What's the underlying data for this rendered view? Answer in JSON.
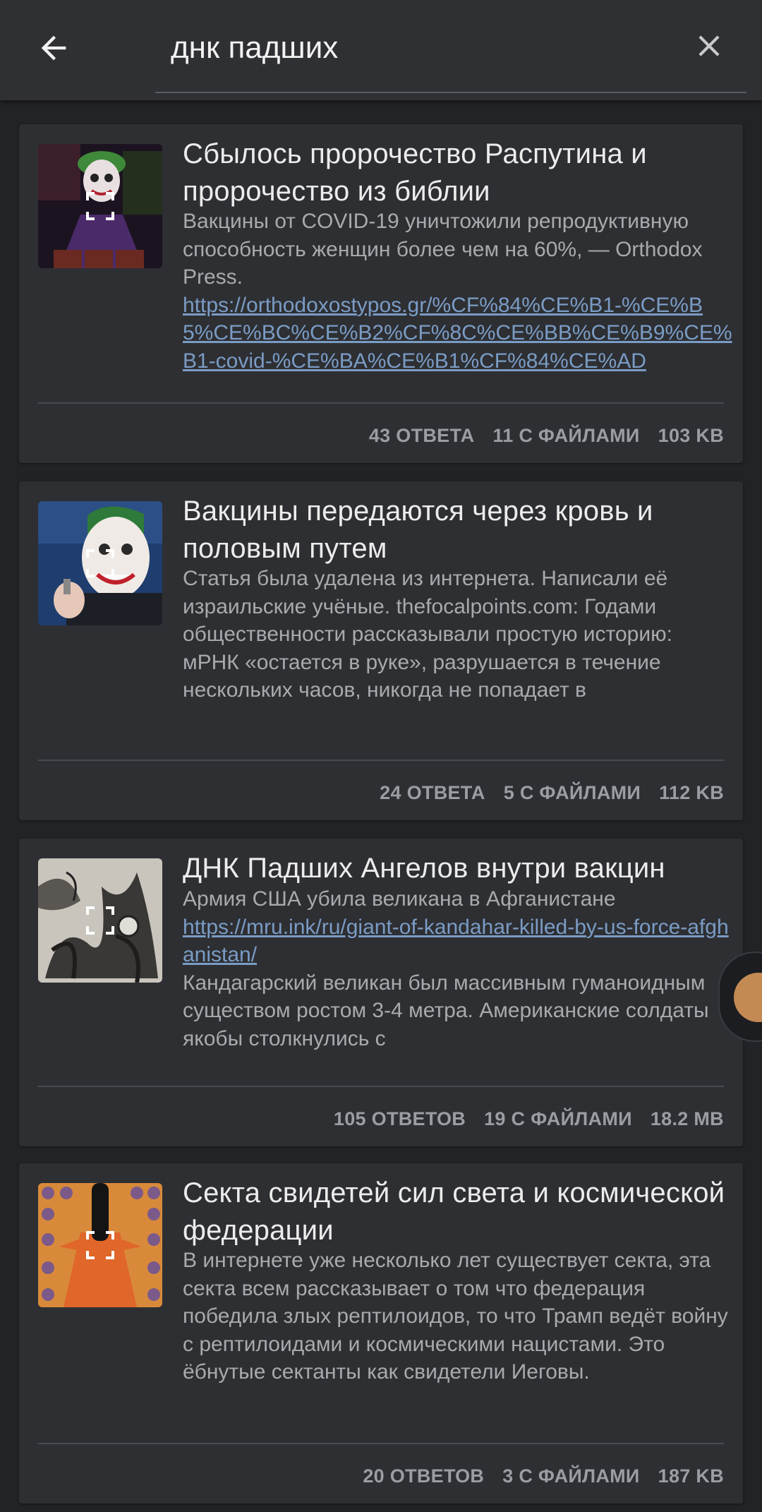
{
  "search": {
    "query": "днк падших"
  },
  "threads": [
    {
      "title": "Сбылось пророчество Распутина и пророчество из библии",
      "body_text": "Вакцины от COVID-19 уничтожили репродуктивную способность женщин более чем на 60%, — Orthodox Press.",
      "link": "https://orthodoxostypos.gr/%CF%84%CE%B1-%CE%B5%CE%BC%CE%B2%CF%8C%CE%BB%CE%B9%CE%B1-covid-%CE%BA%CE%B1%CF%84%CE%AD",
      "replies": "43 ОТВЕТА",
      "files": "11 С ФАЙЛАМИ",
      "size": "103 KB"
    },
    {
      "title": "Вакцины передаются через кровь и половым путем",
      "body_text": "Статья была удалена из интернета. Написали её израильские учёные. thefocalpoints.com: Годами общественности рассказывали простую историю: мРНК «остается в руке», разрушается в течение нескольких часов, никогда не попадает в",
      "replies": "24 ОТВЕТА",
      "files": "5 С ФАЙЛАМИ",
      "size": "112 KB"
    },
    {
      "title": "ДНК Падших Ангелов внутри вакцин",
      "body_text": "Армия США убила великана в Афганистане",
      "link": "https://mru.ink/ru/giant-of-kandahar-killed-by-us-force-afghanistan/",
      "body_text_2": "Кандагарский великан был массивным гуманоидным существом ростом 3-4 метра. Американские солдаты якобы столкнулись с",
      "replies": "105 ОТВЕТОВ",
      "files": "19 С ФАЙЛАМИ",
      "size": "18.2 MB"
    },
    {
      "title": "Секта свидетей сил света и космической федерации",
      "body_text": "В интернете уже несколько лет существует секта, эта секта всем рассказывает о том что федерация победила злых рептилоидов, то что Трамп ведёт войну с рептилоидами и космическими нацистами. Это ёбнутые сектанты как свидетели Иеговы.",
      "replies": "20 ОТВЕТОВ",
      "files": "3 С ФАЙЛАМИ",
      "size": "187 KB"
    }
  ],
  "icons": {
    "back": "arrow-left-icon",
    "close": "close-icon",
    "expand": "expand-icon"
  },
  "colors": {
    "background": "#222327",
    "card": "#2e2f33",
    "link": "#7a9cc5"
  }
}
